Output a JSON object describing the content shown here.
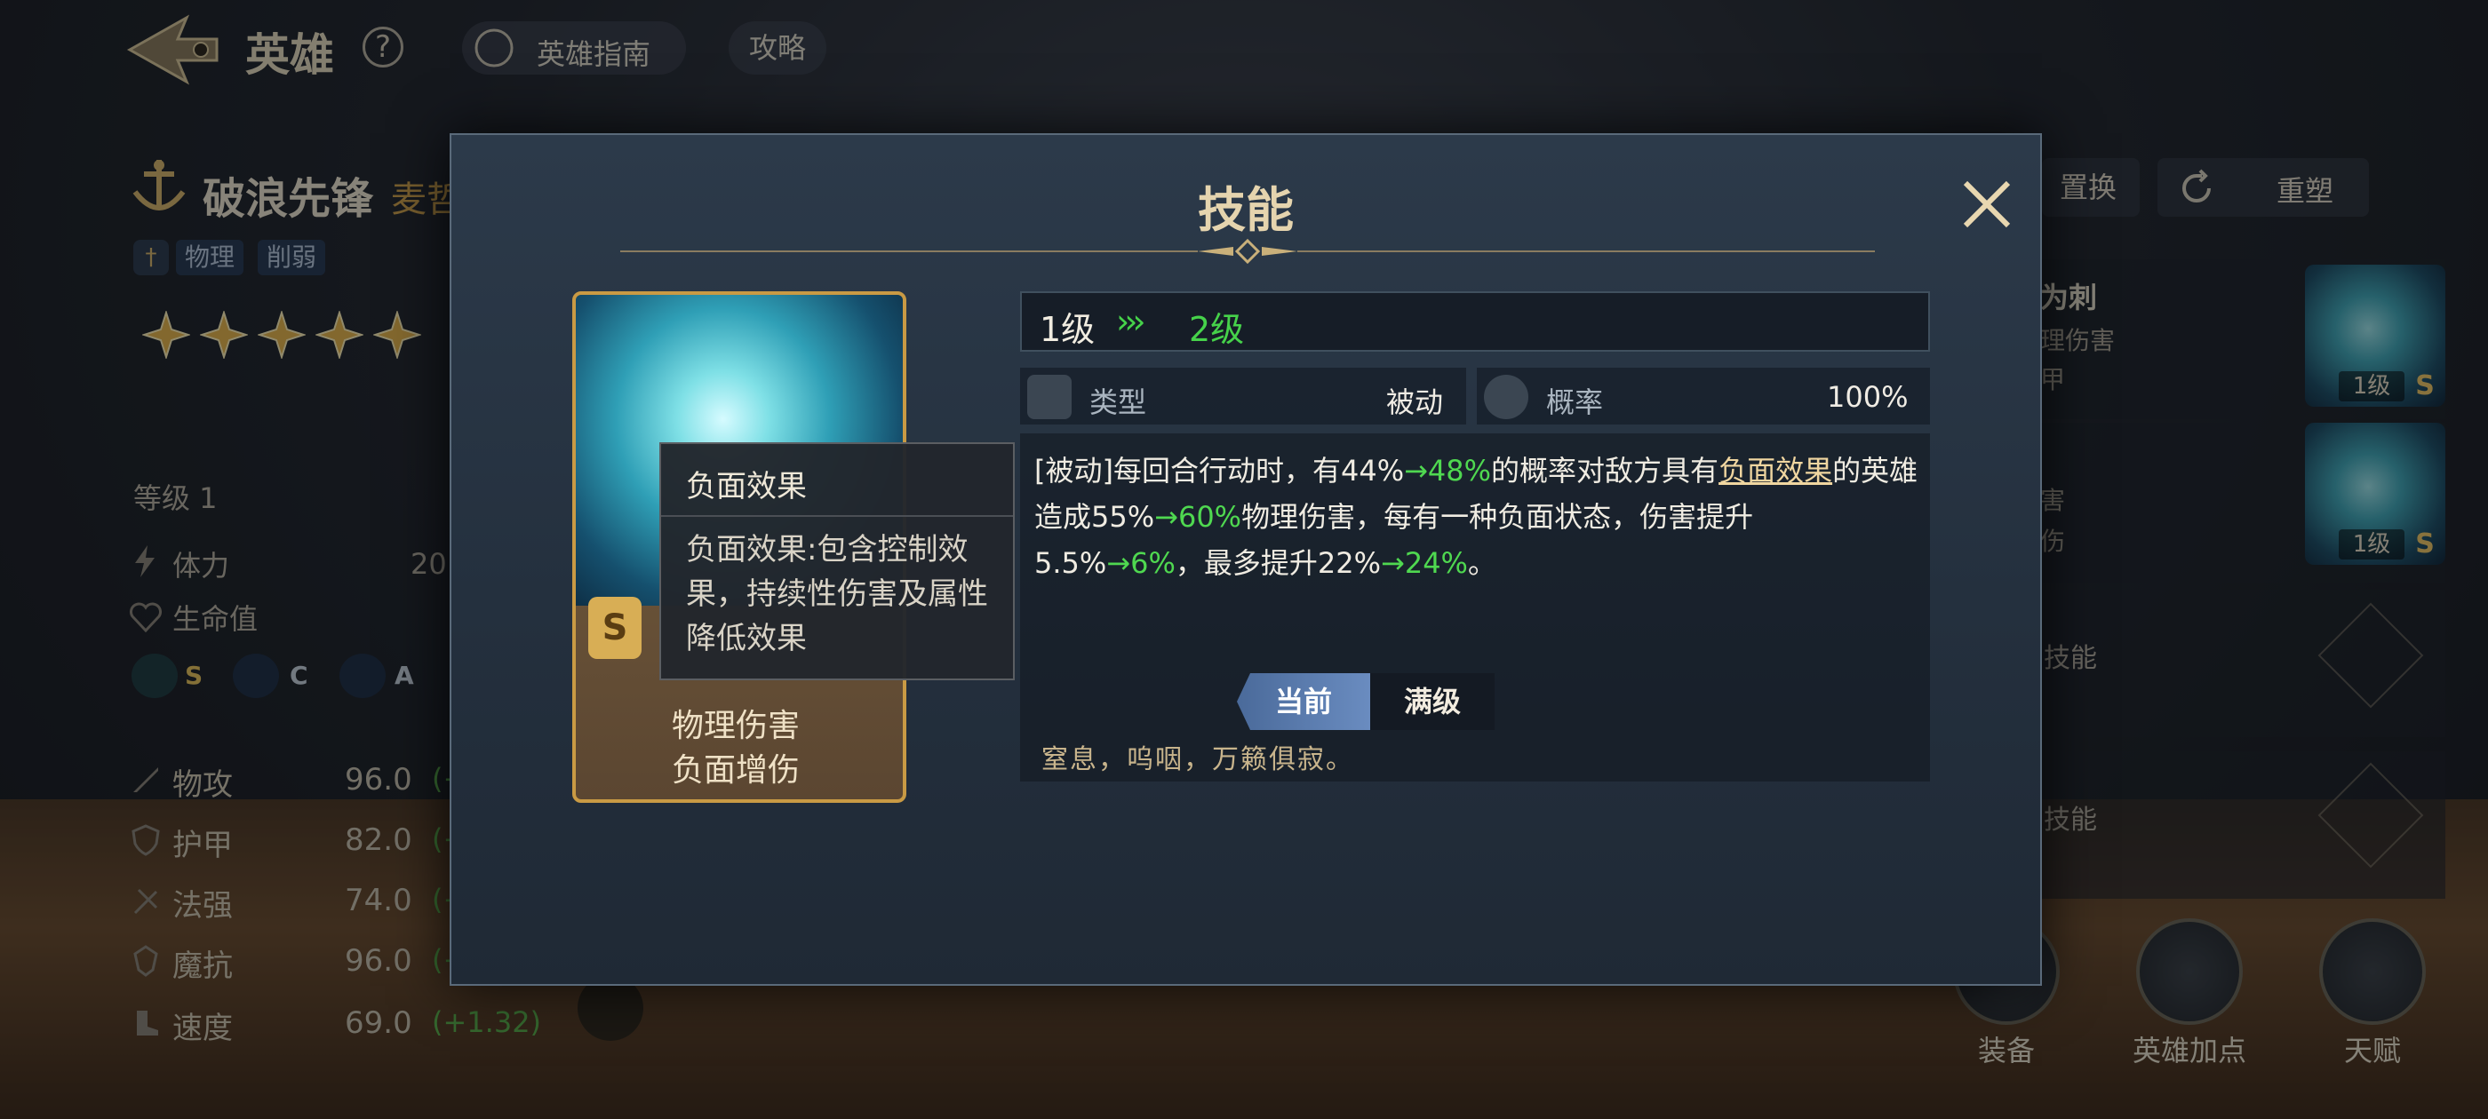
{
  "header": {
    "title": "英雄",
    "help_label": "?",
    "guide_label": "英雄指南",
    "strategy_label": "攻略"
  },
  "hero": {
    "name": "破浪先锋",
    "sub_name": "麦哲",
    "tags": [
      "物理",
      "削弱"
    ],
    "stars": 5,
    "level_label": "等级 1",
    "stamina_label": "体力",
    "stamina_value": "20",
    "hp_label": "生命值",
    "aptitudes": [
      {
        "grade": "S",
        "color": "#e9c35a"
      },
      {
        "grade": "C",
        "color": "#c9d3de"
      },
      {
        "grade": "A",
        "color": "#c9d3de"
      }
    ],
    "attributes": [
      {
        "label": "物攻",
        "value": "96.0",
        "bonus": "(+"
      },
      {
        "label": "护甲",
        "value": "82.0",
        "bonus": "(+"
      },
      {
        "label": "法强",
        "value": "74.0",
        "bonus": "(+"
      },
      {
        "label": "魔抗",
        "value": "96.0",
        "bonus": "(+"
      },
      {
        "label": "速度",
        "value": "69.0",
        "bonus": "(+1.32)"
      }
    ]
  },
  "right_panel": {
    "replace_label": "置换",
    "reshape_label": "重塑",
    "skills": [
      {
        "name": "为刺",
        "line1": "理伤害",
        "line2": "甲",
        "level": "1级",
        "grade": "S"
      },
      {
        "name": "",
        "line1": "害",
        "line2": "伤",
        "level": "1级",
        "grade": "S"
      },
      {
        "locked_label": "技能"
      },
      {
        "locked_label": "技能"
      }
    ],
    "bottom_buttons": [
      "装备",
      "英雄加点",
      "天赋"
    ]
  },
  "modal": {
    "title": "技能",
    "card": {
      "grade": "S",
      "tags": [
        "物理伤害",
        "负面增伤"
      ]
    },
    "level_from": "1级",
    "level_arrow": "›››",
    "level_to": "2级",
    "type_label": "类型",
    "type_value": "被动",
    "rate_label": "概率",
    "rate_value": "100%",
    "desc": {
      "p1": "[被动]每回合行动时，有44%",
      "g1": "→48%",
      "p2": "的概率对敌方具有",
      "link": "负面效果",
      "p3": "的英雄造成55%",
      "g2": "→60%",
      "p4": "物理伤害，每有一种负面状态，伤害提升5.5%",
      "g3": "→6%",
      "p5": "，最多提升22%",
      "g4": "→24%",
      "p6": "。"
    },
    "tab_current": "当前",
    "tab_max": "满级",
    "flavor": "窒息，呜咽，万籁俱寂。",
    "tooltip": {
      "title": "负面效果",
      "body": "负面效果:包含控制效果，持续性伤害及属性降低效果"
    }
  }
}
